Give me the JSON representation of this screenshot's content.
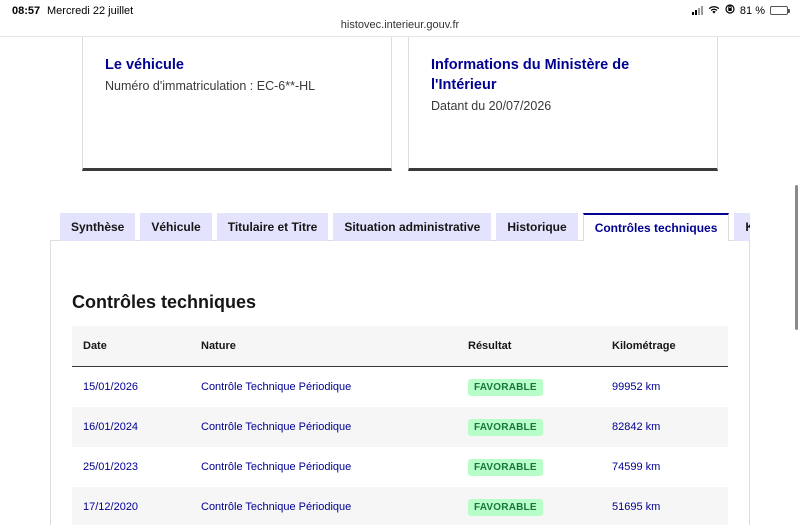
{
  "status_bar": {
    "time": "08:57",
    "date": "Mercredi 22 juillet",
    "battery": "81 %",
    "battery_level": 0.81,
    "icons": [
      "signal-icon",
      "wifi-icon",
      "orientation-lock-icon",
      "battery-icon"
    ]
  },
  "browser": {
    "url": "histovec.interieur.gouv.fr"
  },
  "cards": {
    "vehicule": {
      "title": "Le véhicule",
      "text": "Numéro d'immatriculation : EC-6**-HL"
    },
    "ministere": {
      "title_line1": "Informations du Ministère de",
      "title_line2": "l'Intérieur",
      "text": "Datant du 20/07/2026"
    }
  },
  "tabs": [
    {
      "label": "Synthèse",
      "active": false
    },
    {
      "label": "Véhicule",
      "active": false
    },
    {
      "label": "Titulaire et Titre",
      "active": false
    },
    {
      "label": "Situation administrative",
      "active": false
    },
    {
      "label": "Historique",
      "active": false
    },
    {
      "label": "Contrôles techniques",
      "active": true
    },
    {
      "label": "Kil",
      "active": false
    }
  ],
  "section": {
    "title": "Contrôles techniques"
  },
  "table": {
    "headers": {
      "date": "Date",
      "nature": "Nature",
      "result": "Résultat",
      "km": "Kilométrage"
    },
    "rows": [
      {
        "date": "15/01/2026",
        "nature": "Contrôle Technique Périodique",
        "result": "FAVORABLE",
        "km": "99952 km"
      },
      {
        "date": "16/01/2024",
        "nature": "Contrôle Technique Périodique",
        "result": "FAVORABLE",
        "km": "82842 km"
      },
      {
        "date": "25/01/2023",
        "nature": "Contrôle Technique Périodique",
        "result": "FAVORABLE",
        "km": "74599 km"
      },
      {
        "date": "17/12/2020",
        "nature": "Contrôle Technique Périodique",
        "result": "FAVORABLE",
        "km": "51695 km"
      }
    ]
  },
  "colors": {
    "primary": "#000091",
    "tab_bg": "#e3e3fd",
    "badge_bg": "#b8fec9",
    "badge_text": "#18753c",
    "row_alt": "#f6f6f6"
  }
}
